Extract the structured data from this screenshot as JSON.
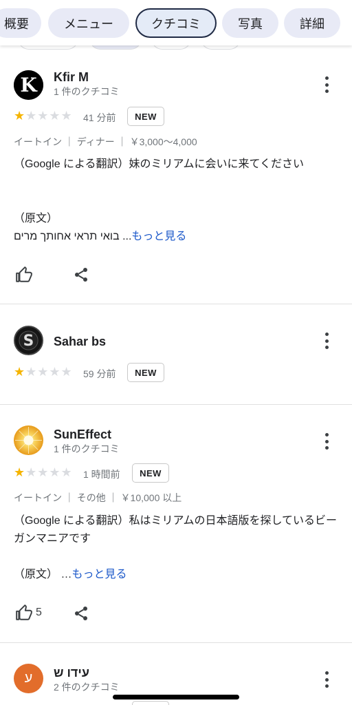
{
  "tabs": [
    {
      "label": "概要"
    },
    {
      "label": "メニュー"
    },
    {
      "label": "クチコミ"
    },
    {
      "label": "写真"
    },
    {
      "label": "詳細"
    }
  ],
  "colors": {
    "star_on": "#f5b400",
    "star_off": "#dadce0",
    "link": "#1a57c9",
    "tab_bg": "#e8eaf6"
  },
  "reviews": [
    {
      "name": "Kfir M",
      "subtitle": "1 件のクチコミ",
      "rating": 1,
      "time": "41 分前",
      "badge": "NEW",
      "meta": "イートイン ｜ ディナー ｜ ￥3,000〜4,000",
      "translated": "（Google による翻訳）妹のミリアムに会いに来てください",
      "original_label": "（原文）",
      "original_text": "בואי תראי אחותך מרים ...",
      "more_link": "もっと見る",
      "likes": ""
    },
    {
      "name": "Sahar bs",
      "subtitle": "",
      "rating": 1,
      "time": "59 分前",
      "badge": "NEW"
    },
    {
      "name": "SunEffect",
      "subtitle": "1 件のクチコミ",
      "rating": 1,
      "time": "1 時間前",
      "badge": "NEW",
      "meta": "イートイン ｜ その他 ｜ ￥10,000 以上",
      "translated": "（Google による翻訳）私はミリアムの日本語版を探しているビーガンマニアです",
      "original_label": "（原文）",
      "original_text": "…",
      "more_link": "もっと見る",
      "likes": "5"
    },
    {
      "name": "עידו ש",
      "subtitle": "2 件のクチコミ",
      "avatar_letter": "ע"
    }
  ]
}
